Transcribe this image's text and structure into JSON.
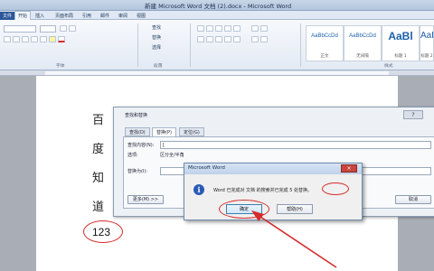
{
  "window": {
    "title": "新建 Microsoft Word 文档 (2).docx - Microsoft Word"
  },
  "ribbon": {
    "tabs": [
      {
        "label": "文件"
      },
      {
        "label": "开始"
      },
      {
        "label": "插入"
      },
      {
        "label": "页面布局"
      },
      {
        "label": "引用"
      },
      {
        "label": "邮件"
      },
      {
        "label": "审阅"
      },
      {
        "label": "视图"
      }
    ],
    "groups": {
      "font": "字体",
      "paragraph": "段落",
      "styles": "样式"
    },
    "edit_items": [
      "查找",
      "替换",
      "选择"
    ],
    "styles": [
      {
        "preview": "AaBbCcDd",
        "caption": "正文"
      },
      {
        "preview": "AaBbCcDd",
        "caption": "无间隔"
      },
      {
        "preview": "AaBl",
        "caption": "标题 1"
      },
      {
        "preview": "AaBbC",
        "caption": "标题 2"
      }
    ]
  },
  "document": {
    "chars": [
      "百",
      "度",
      "知",
      "道"
    ],
    "number_text": "123"
  },
  "find_dialog": {
    "title": "查找和替换",
    "tabs": [
      "查找(D)",
      "替换(P)",
      "定位(G)"
    ],
    "find_label": "查找内容(N):",
    "find_value": "[",
    "options_label": "选项:",
    "options_value": "区分全/半角",
    "replace_label": "替换为(I):",
    "more_button": "更多(M) >>",
    "cancel_button": "取消"
  },
  "message_box": {
    "title": "Microsoft Word",
    "message": "Word 已完成对 文档 的搜索并已完成 5 处替换。",
    "ok_button": "确定",
    "help_button": "帮助(H)"
  },
  "annotation_color": "#d42b2b"
}
